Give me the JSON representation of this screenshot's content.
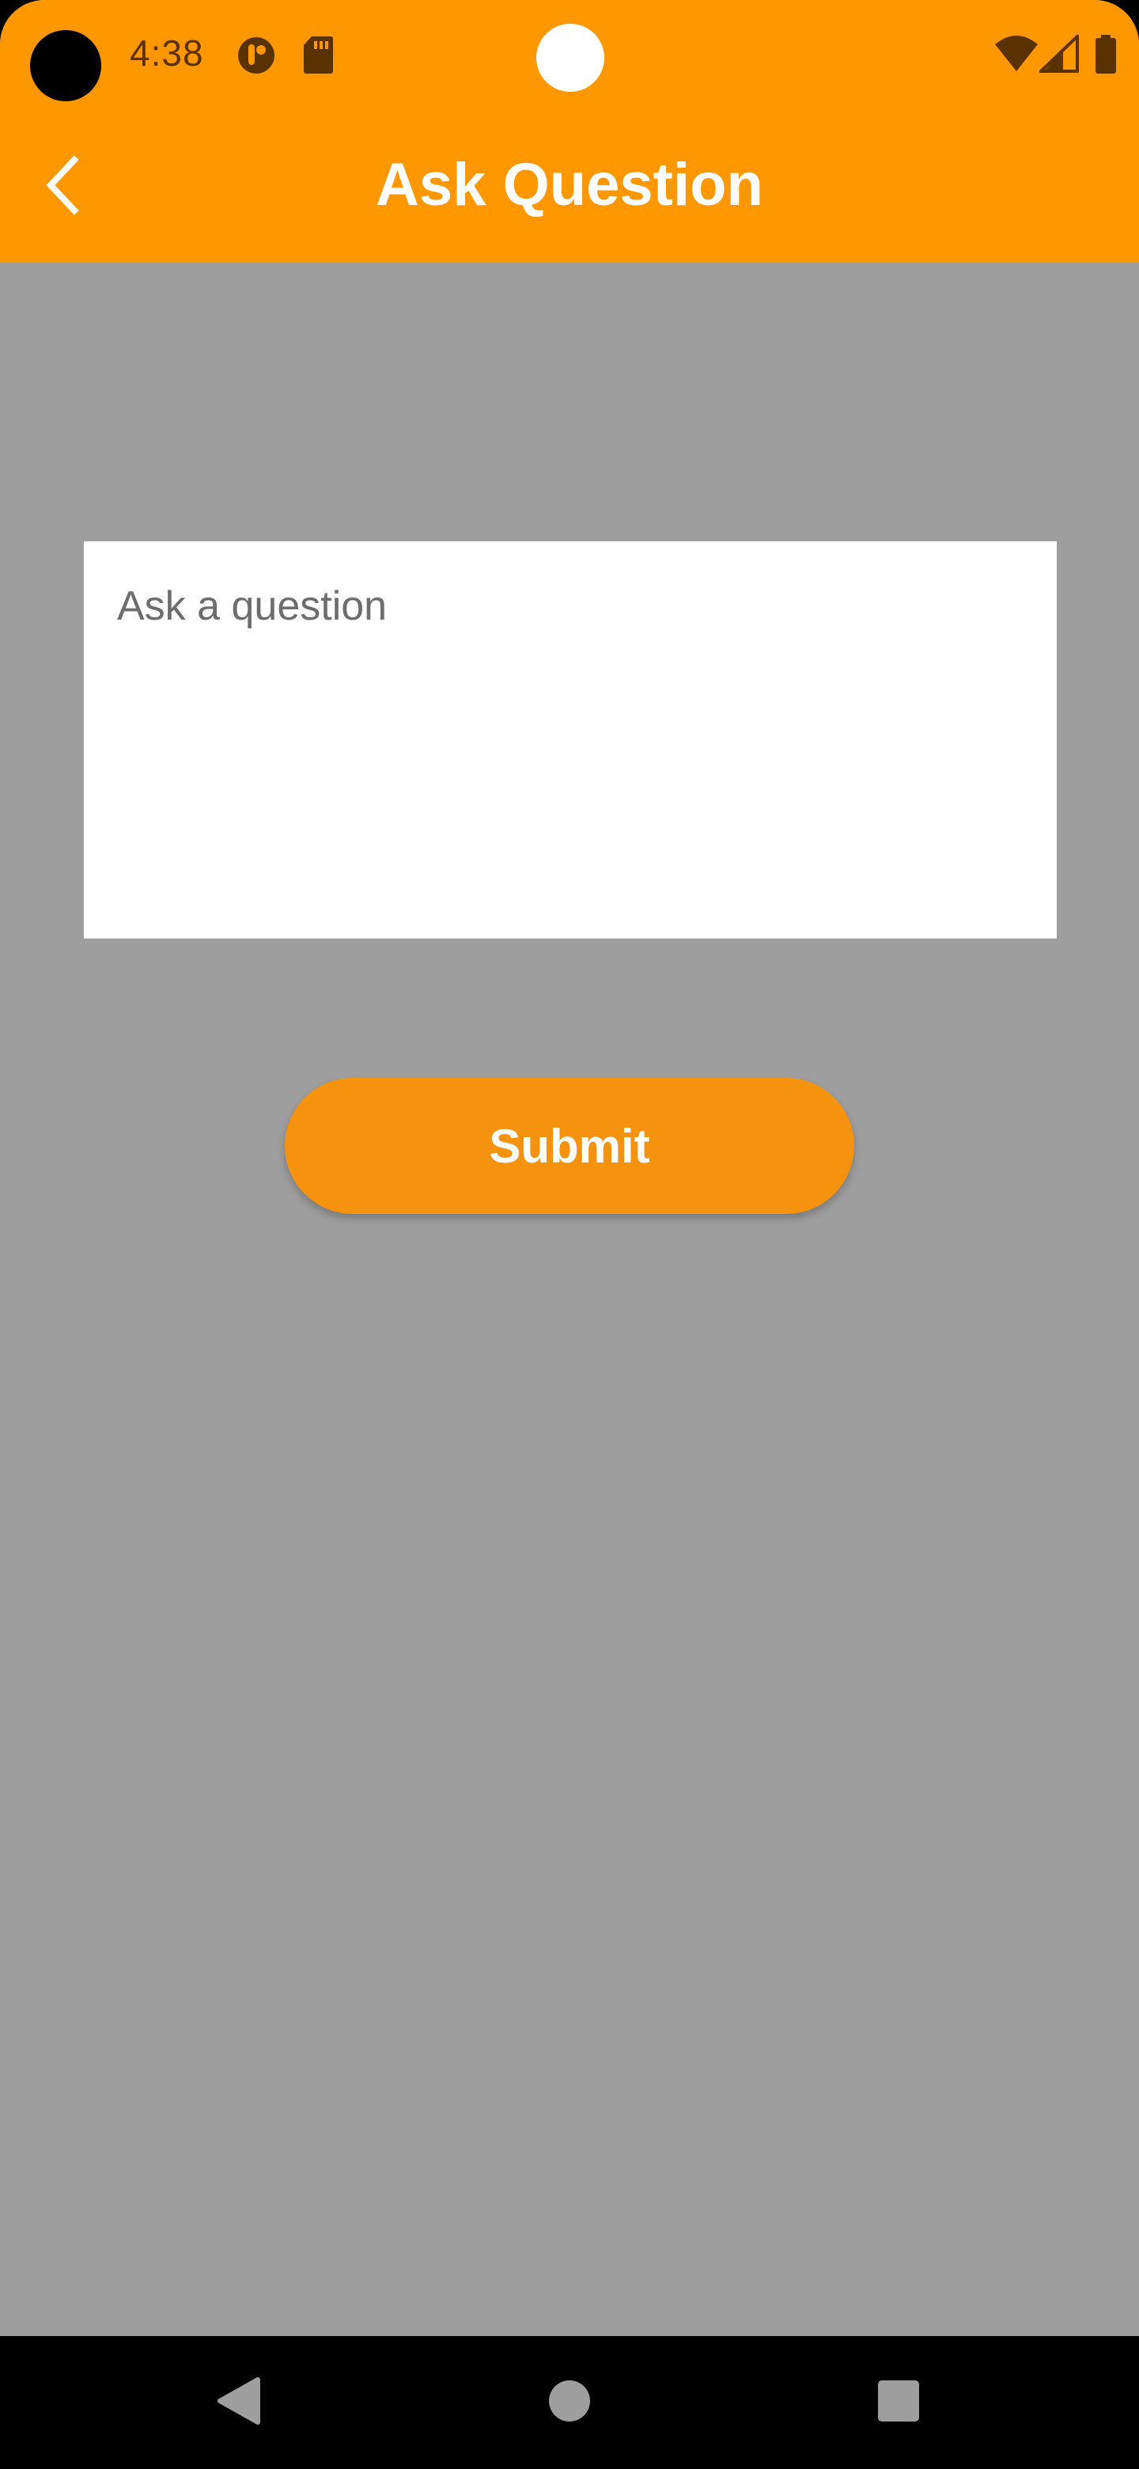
{
  "status_bar": {
    "time": "4:38",
    "icons": [
      "camera-cutout-icon",
      "app-notification-icon",
      "sd-card-icon",
      "wifi-icon",
      "cellular-signal-icon",
      "battery-icon"
    ]
  },
  "app_bar": {
    "title": "Ask Question",
    "back_icon": "chevron-left-icon",
    "color": "#ff9800"
  },
  "form": {
    "question_placeholder": "Ask a question",
    "question_value": "",
    "submit_label": "Submit"
  },
  "nav_bar": {
    "icons": [
      "back-triangle-icon",
      "home-circle-icon",
      "recents-square-icon"
    ]
  },
  "colors": {
    "accent": "#ff9800",
    "button": "#f5930e",
    "background": "#9e9e9e"
  }
}
